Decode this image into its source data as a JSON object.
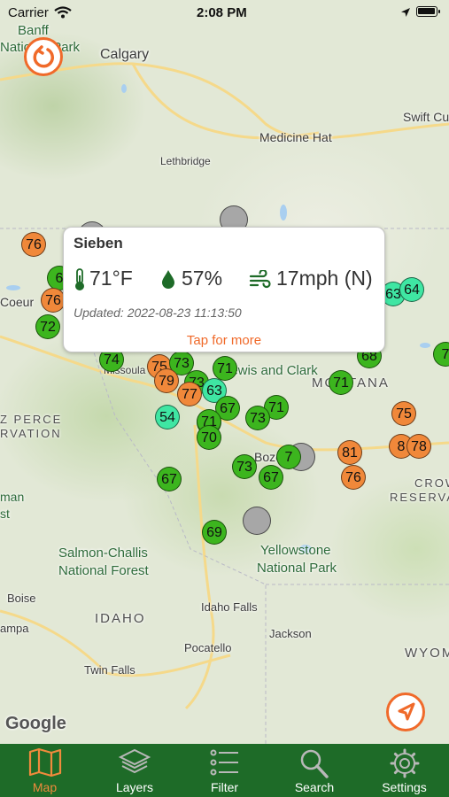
{
  "status_bar": {
    "carrier": "Carrier",
    "time": "2:08 PM"
  },
  "map": {
    "labels": {
      "banff": "Banff",
      "banff_park": "National Park",
      "calgary": "Calgary",
      "swift_current": "Swift Cur",
      "medicine_hat": "Medicine Hat",
      "lethbridge": "Lethbridge",
      "coeur": "Coeur",
      "missoula": "Missoula",
      "lewis_clark": "Lewis and Clark",
      "montana": "MONTANA",
      "nez_perce": "Z PERCE",
      "reservation": "RVATION",
      "bozeman": "Boze",
      "crow": "CROW",
      "crow_reservation": "RESERVA",
      "man": "man",
      "st": "st",
      "salmon_challis_1": "Salmon-Challis",
      "salmon_challis_2": "National Forest",
      "yellowstone_1": "Yellowstone",
      "yellowstone_2": "National Park",
      "idaho": "IDAHO",
      "boise": "Boise",
      "ampa": "ampa",
      "idaho_falls": "Idaho Falls",
      "jackson": "Jackson",
      "wyoming": "WYOM",
      "pocatello": "Pocatello",
      "twin_falls": "Twin Falls"
    },
    "markers": [
      "76",
      "6",
      "76",
      "72",
      "63",
      "64",
      "74",
      "75",
      "73",
      "71",
      "79",
      "73",
      "71",
      "68",
      "7",
      "77",
      "63",
      "67",
      "71",
      "71",
      "73",
      "54",
      "71",
      "70",
      "75",
      "73",
      "7",
      "81",
      "8",
      "78",
      "67",
      "67",
      "76",
      "69"
    ],
    "attribution": "Google"
  },
  "popup": {
    "station": "Sieben",
    "temperature": "71°F",
    "humidity": "57%",
    "wind": "17mph (N)",
    "updated": "Updated: 2022-08-23 11:13:50",
    "action": "Tap for more"
  },
  "tabs": [
    {
      "label": "Map",
      "icon": "map-icon"
    },
    {
      "label": "Layers",
      "icon": "layers-icon"
    },
    {
      "label": "Filter",
      "icon": "filter-icon"
    },
    {
      "label": "Search",
      "icon": "search-icon"
    },
    {
      "label": "Settings",
      "icon": "settings-icon"
    }
  ],
  "colors": {
    "accent": "#f08a3c",
    "tab_bar": "#1e6b28",
    "marker_green": "#3cb51e",
    "marker_orange": "#f0883a",
    "marker_mint": "#3fe6a3"
  }
}
